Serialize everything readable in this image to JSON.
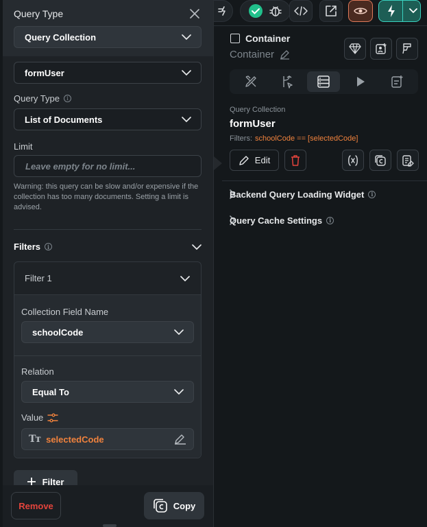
{
  "popup": {
    "title": "Query Type",
    "query_collection_select": "Query Collection",
    "collection_select": "formUser",
    "query_type_label": "Query Type",
    "query_type_select": "List of Documents",
    "limit_label": "Limit",
    "limit_placeholder": "Leave empty for no limit...",
    "warning": "Warning: this query can be slow and/or expensive if the collection has too many documents. Setting a limit is advised.",
    "filters_label": "Filters",
    "filter": {
      "title": "Filter 1",
      "field_label": "Collection Field Name",
      "field_value": "schoolCode",
      "relation_label": "Relation",
      "relation_value": "Equal To",
      "value_label": "Value",
      "value_type_glyph": "Tт",
      "value": "selectedCode"
    },
    "add_filter_label": "Filter",
    "remove_label": "Remove",
    "copy_label": "Copy"
  },
  "right": {
    "container_title": "Container",
    "container_subtitle": "Container",
    "query_collection_label": "Query Collection",
    "query_collection_name": "formUser",
    "filters_prefix": "Filters:",
    "filters_value": "schoolCode == [selectedCode]",
    "edit_label": "Edit",
    "backend_query_label": "Backend Query Loading Widget",
    "query_cache_label": "Query Cache Settings"
  },
  "colors": {
    "accent_orange": "#f0823d",
    "danger_red": "#e4443c",
    "success_green": "#21c08b",
    "teal": "#39d2c0"
  }
}
